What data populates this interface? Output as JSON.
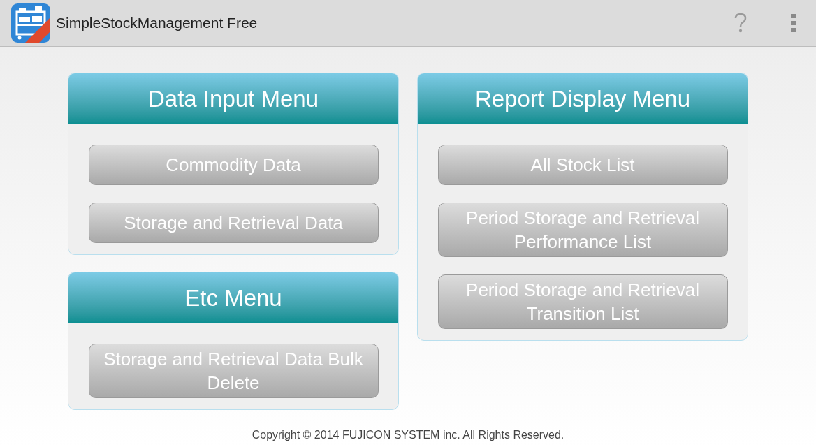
{
  "action_bar": {
    "title": "SimpleStockManagement Free"
  },
  "columns": [
    [
      {
        "title": "Data Input Menu",
        "buttons": [
          "Commodity Data",
          "Storage and Retrieval Data"
        ]
      },
      {
        "title": "Etc Menu",
        "buttons": [
          "Storage and Retrieval Data Bulk Delete"
        ]
      }
    ],
    [
      {
        "title": "Report Display Menu",
        "buttons": [
          "All Stock List",
          "Period Storage and Retrieval Performance List",
          "Period Storage and Retrieval Transition List"
        ]
      }
    ]
  ],
  "footer": "Copyright © 2014 FUJICON SYSTEM inc. All Rights Reserved."
}
